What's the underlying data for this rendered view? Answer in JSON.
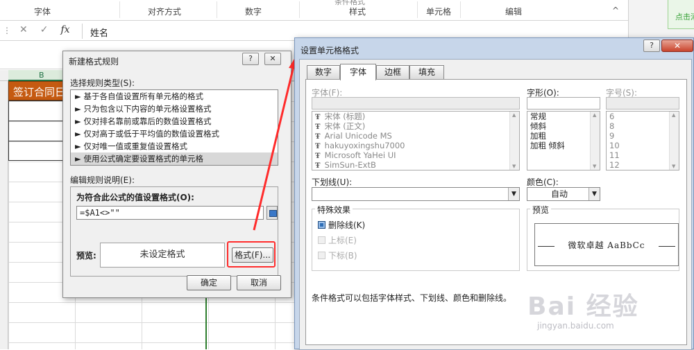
{
  "ribbon": {
    "groups": [
      "字体",
      "对齐方式",
      "数字",
      "样式",
      "单元格",
      "编辑"
    ],
    "cut_text": "条件格式",
    "collapse_icon": "^"
  },
  "side_panel": {
    "button_label": "点击添"
  },
  "formula_bar": {
    "dots": "⋮",
    "cancel_icon": "✕",
    "confirm_icon": "✓",
    "fx": "fx",
    "content": "姓名"
  },
  "sheet": {
    "column_b": "B",
    "cell_b1": "签订合同日"
  },
  "rule_dialog": {
    "title": "新建格式规则",
    "help": "?",
    "close": "✕",
    "select_type_label": "选择规则类型(S):",
    "rule_types": [
      "► 基于各自值设置所有单元格的格式",
      "► 只为包含以下内容的单元格设置格式",
      "► 仅对排名靠前或靠后的数值设置格式",
      "► 仅对高于或低于平均值的数值设置格式",
      "► 仅对唯一值或重复值设置格式",
      "► 使用公式确定要设置格式的单元格"
    ],
    "edit_desc_label": "编辑规则说明(E):",
    "formula_label": "为符合此公式的值设置格式(O):",
    "formula_value": "=$A1<>\"\"",
    "preview_label": "预览:",
    "preview_text": "未设定格式",
    "format_button": "格式(F)...",
    "ok": "确定",
    "cancel": "取消"
  },
  "cells_dialog": {
    "title": "设置单元格格式",
    "help": "?",
    "close": "✕",
    "tabs": [
      "数字",
      "字体",
      "边框",
      "填充"
    ],
    "active_tab": "字体",
    "font_label": "字体(F):",
    "fonts": [
      "宋体 (标题)",
      "宋体 (正文)",
      "Arial Unicode MS",
      "hakuyoxingshu7000",
      "Microsoft YaHei UI",
      "SimSun-ExtB"
    ],
    "style_label": "字形(O):",
    "styles": [
      "常规",
      "倾斜",
      "加粗",
      "加粗 倾斜"
    ],
    "size_label": "字号(S):",
    "sizes": [
      "6",
      "8",
      "9",
      "10",
      "11",
      "12"
    ],
    "underline_label": "下划线(U):",
    "color_label": "颜色(C):",
    "color_value": "自动",
    "effects_label": "特殊效果",
    "strikethrough": "删除线(K)",
    "superscript": "上标(E)",
    "subscript": "下标(B)",
    "preview_label": "预览",
    "preview_text": "微软卓越  AaBbCc",
    "note": "条件格式可以包括字体样式、下划线、颜色和删除线。"
  },
  "watermark": {
    "main": "Bai 经验",
    "sub": "jingyan.baidu.com"
  },
  "colors": {
    "header_orange": "#c55a11",
    "highlight_red": "#ff2b2b",
    "excel_green": "#217346"
  }
}
